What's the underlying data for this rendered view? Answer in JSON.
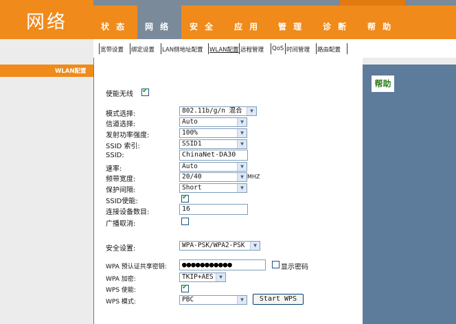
{
  "header": {
    "title": "网络",
    "nav": [
      "状 态",
      "网 络",
      "安 全",
      "应 用",
      "管 理",
      "诊 断",
      "帮 助"
    ]
  },
  "subnav": [
    "宽带设置",
    "绑定设置",
    "LAN侧地址配置",
    "WLAN配置",
    "远程管理",
    "QoS",
    "时间管理",
    "路由配置"
  ],
  "sidebar": {
    "active": "WLAN配置"
  },
  "form": {
    "enable_wireless": {
      "label": "使能无线",
      "checked": true
    },
    "mode": {
      "label": "模式选择:",
      "value": "802.11b/g/n 混合"
    },
    "channel": {
      "label": "信道选择:",
      "value": "Auto"
    },
    "tx_power": {
      "label": "发射功率强度:",
      "value": "100%"
    },
    "ssid_index": {
      "label": "SSID 索引:",
      "value": "SSID1"
    },
    "ssid": {
      "label": "SSID:",
      "value": "ChinaNet-DA30"
    },
    "rate": {
      "label": "速率:",
      "value": "Auto"
    },
    "bandwidth": {
      "label": "频带宽度:",
      "value": "20/40",
      "unit": "MHZ"
    },
    "guard": {
      "label": "保护间隔:",
      "value": "Short"
    },
    "ssid_enable": {
      "label": "SSID使能:",
      "checked": true
    },
    "max_devices": {
      "label": "连接设备数目:",
      "value": "16"
    },
    "broadcast_cancel": {
      "label": "广播取消:",
      "checked": false
    },
    "security": {
      "label": "安全设置:",
      "value": "WPA-PSK/WPA2-PSK"
    },
    "wpa_key": {
      "label": "WPA 预认证共享密钥:",
      "value": "●●●●●●●●●●●",
      "show_label": "显示密码",
      "show_checked": false
    },
    "wpa_encrypt": {
      "label": "WPA 加密:",
      "value": "TKIP+AES"
    },
    "wps_enable": {
      "label": "WPS 使能:",
      "checked": true
    },
    "wps_mode": {
      "label": "WPS 模式:",
      "value": "PBC",
      "button": "Start WPS"
    }
  },
  "help": {
    "title": "帮助"
  },
  "colors": {
    "accent": "#f08a1a",
    "nav_active": "#7a8a9a",
    "help_panel": "#5d7b9b",
    "help_title": "#2e7a1e",
    "check": "#21a121"
  }
}
